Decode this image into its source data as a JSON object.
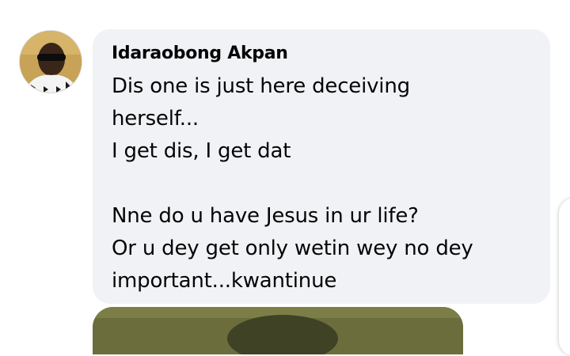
{
  "comment": {
    "author": "Idaraobong Akpan",
    "text": "Dis one is just here deceiving\nherself...\nI get dis,  I get dat\n\nNne do u have Jesus in ur life?\nOr u dey get only wetin wey no dey\nimportant...kwantinue"
  },
  "colors": {
    "bubble": "#f0f2f5",
    "text": "#050505",
    "attachment": "#6b6e3c"
  }
}
